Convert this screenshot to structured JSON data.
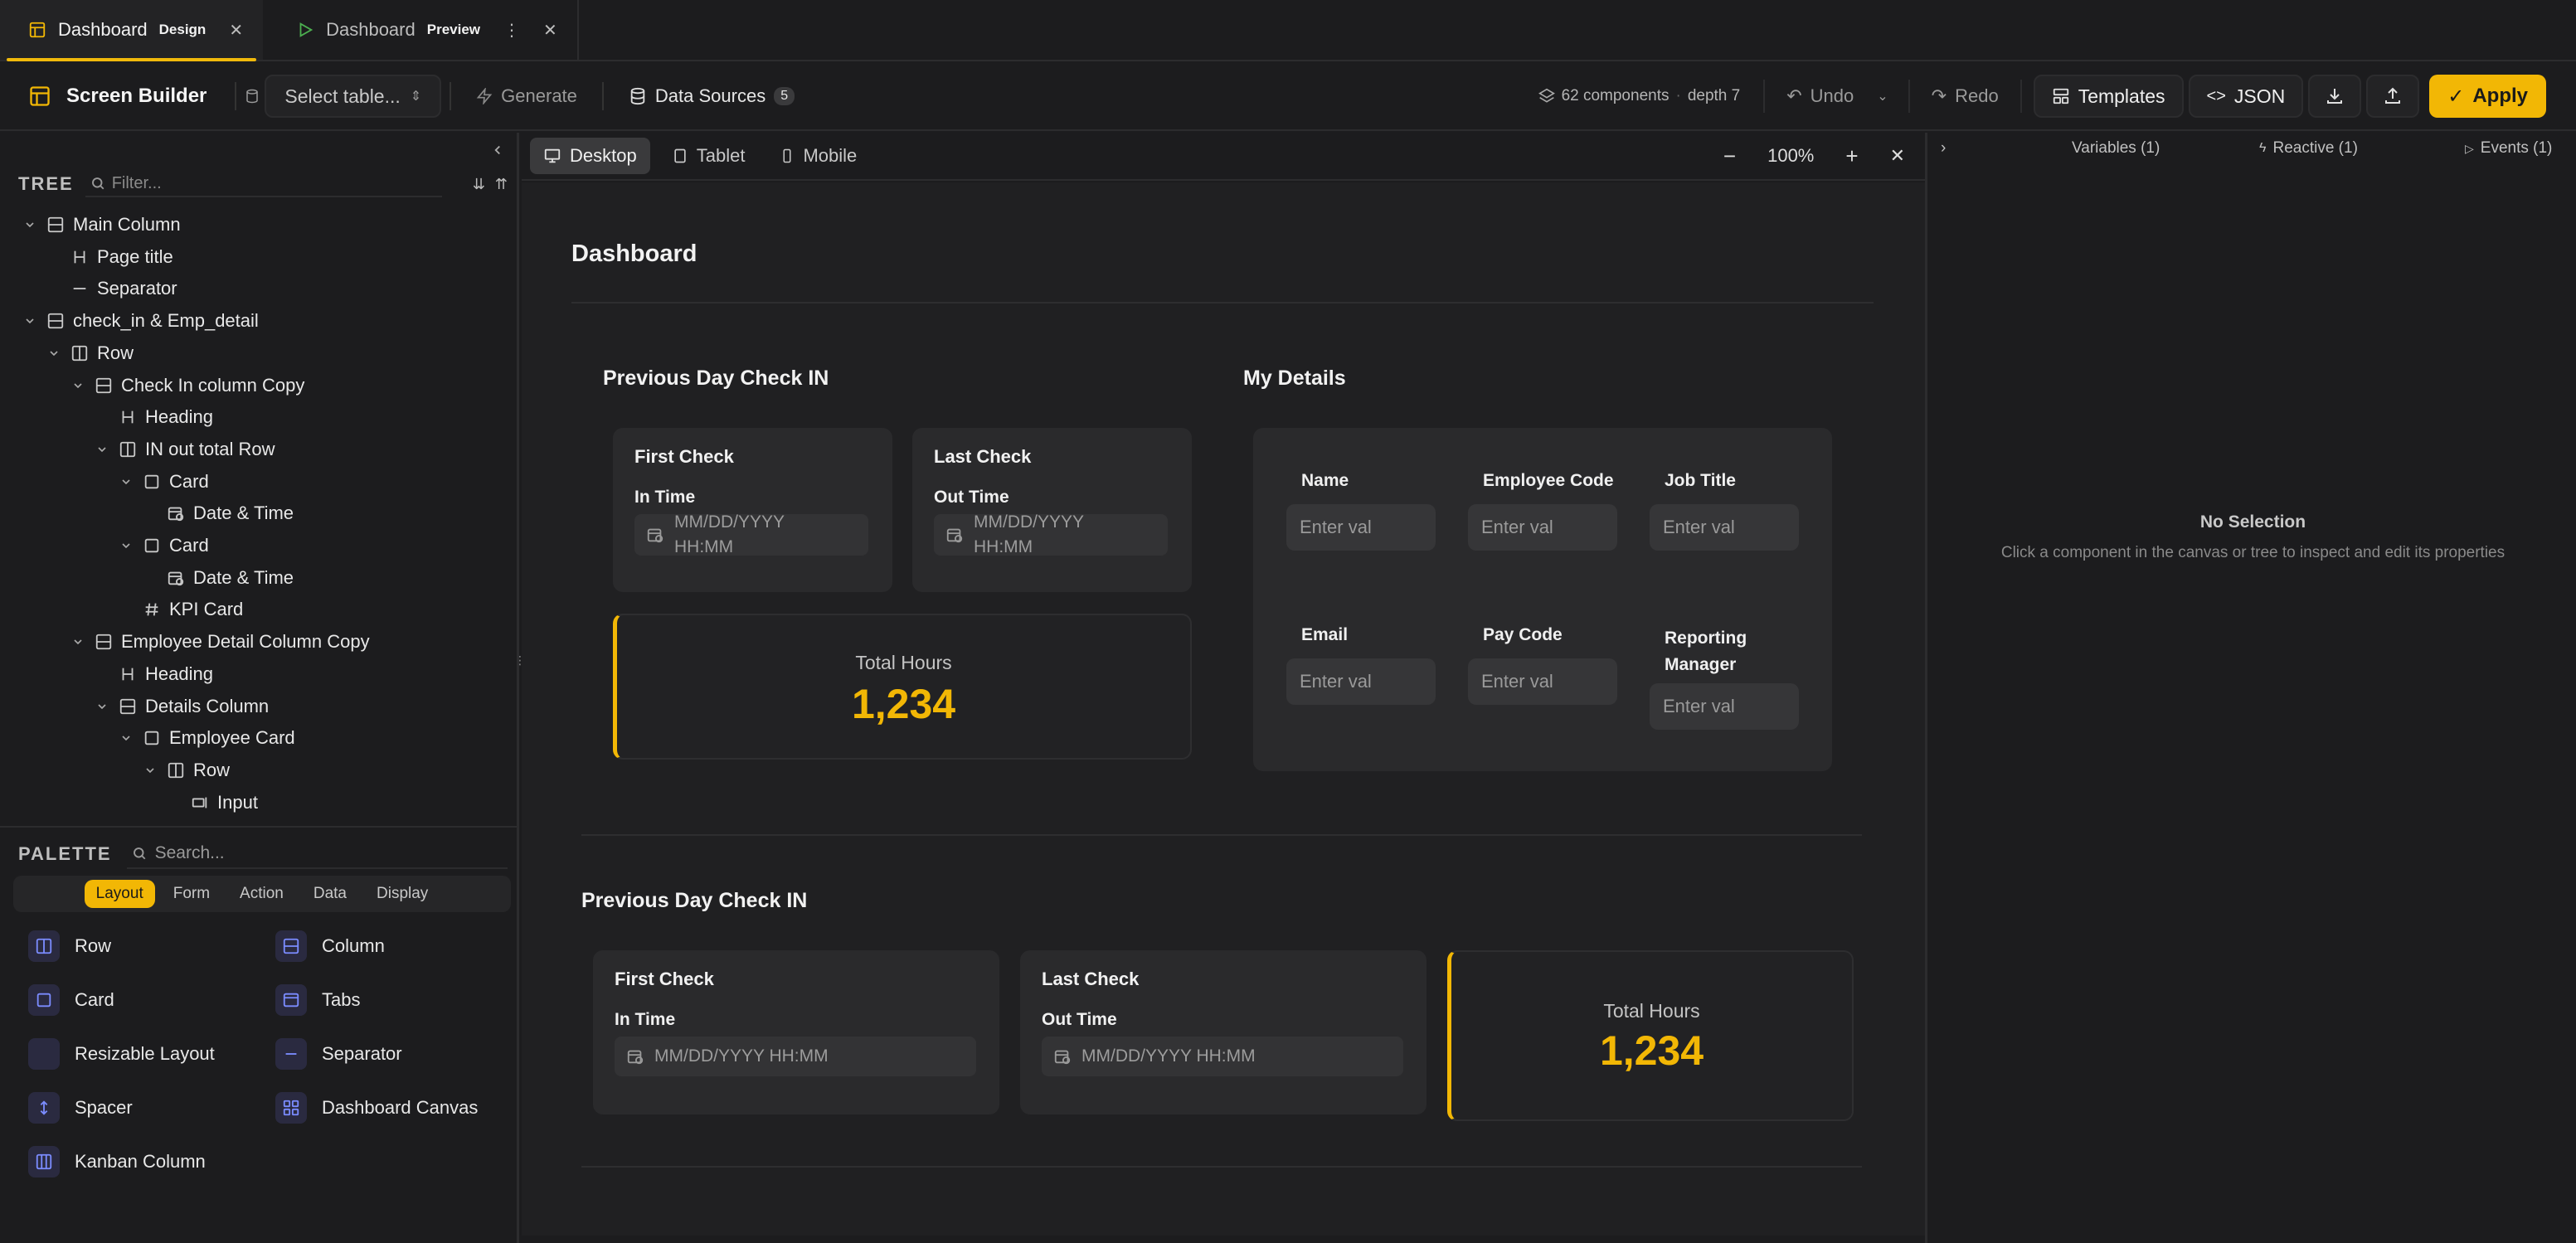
{
  "tabs": [
    {
      "label": "Dashboard",
      "badge": "Design"
    },
    {
      "label": "Dashboard",
      "badge": "Preview"
    }
  ],
  "toolbar": {
    "title": "Screen Builder",
    "select_table": "Select table...",
    "generate": "Generate",
    "data_sources": "Data Sources",
    "data_sources_count": "5",
    "components": "62 components",
    "depth": "depth 7",
    "undo": "Undo",
    "redo": "Redo",
    "templates": "Templates",
    "json": "JSON",
    "apply": "Apply"
  },
  "tree": {
    "label": "TREE",
    "filter_placeholder": "Filter...",
    "nodes": [
      {
        "label": "Main Column",
        "icon": "column-icon"
      },
      {
        "label": "Page title",
        "icon": "heading-icon"
      },
      {
        "label": "Separator",
        "icon": "separator-icon"
      },
      {
        "label": "check_in & Emp_detail",
        "icon": "column-icon"
      },
      {
        "label": "Row",
        "icon": "row-icon"
      },
      {
        "label": "Check In column Copy",
        "icon": "column-icon"
      },
      {
        "label": "Heading",
        "icon": "heading-icon"
      },
      {
        "label": "IN out total Row",
        "icon": "row-icon"
      },
      {
        "label": "Card",
        "icon": "card-icon"
      },
      {
        "label": "Date & Time",
        "icon": "calendar-clock-icon"
      },
      {
        "label": "Card",
        "icon": "card-icon"
      },
      {
        "label": "Date & Time",
        "icon": "calendar-clock-icon"
      },
      {
        "label": "KPI Card",
        "icon": "hash-icon"
      },
      {
        "label": "Employee Detail Column Copy",
        "icon": "column-icon"
      },
      {
        "label": "Heading",
        "icon": "heading-icon"
      },
      {
        "label": "Details Column",
        "icon": "column-icon"
      },
      {
        "label": "Employee Card",
        "icon": "card-icon"
      },
      {
        "label": "Row",
        "icon": "row-icon"
      },
      {
        "label": "Input",
        "icon": "input-icon"
      }
    ]
  },
  "palette": {
    "label": "PALETTE",
    "search_placeholder": "Search...",
    "categories": [
      "Layout",
      "Form",
      "Action",
      "Data",
      "Display"
    ],
    "active_category": "Layout",
    "items": [
      {
        "label": "Row",
        "icon": "row-icon"
      },
      {
        "label": "Column",
        "icon": "column-icon"
      },
      {
        "label": "Card",
        "icon": "card-icon"
      },
      {
        "label": "Tabs",
        "icon": "tabs-icon"
      },
      {
        "label": "Resizable Layout",
        "icon": "resizable-icon"
      },
      {
        "label": "Separator",
        "icon": "separator-icon"
      },
      {
        "label": "Spacer",
        "icon": "spacer-icon"
      },
      {
        "label": "Dashboard Canvas",
        "icon": "dashboard-canvas-icon"
      },
      {
        "label": "Kanban Column",
        "icon": "kanban-icon"
      }
    ]
  },
  "canvas": {
    "viewports": [
      "Desktop",
      "Tablet",
      "Mobile"
    ],
    "active_viewport": "Desktop",
    "zoom": "100%",
    "page_title": "Dashboard",
    "checkin": {
      "heading": "Previous Day Check IN",
      "first_card_title": "First Check",
      "first_label": "In Time",
      "first_placeholder": "MM/DD/YYYY HH:MM",
      "last_card_title": "Last Check",
      "last_label": "Out Time",
      "last_placeholder": "MM/DD/YYYY HH:MM",
      "kpi_label": "Total Hours",
      "kpi_value": "1,234"
    },
    "details": {
      "heading": "My Details",
      "fields": [
        {
          "label": "Name",
          "placeholder": "Enter val"
        },
        {
          "label": "Employee Code",
          "placeholder": "Enter val"
        },
        {
          "label": "Job Title",
          "placeholder": "Enter val"
        },
        {
          "label": "Email",
          "placeholder": "Enter val"
        },
        {
          "label": "Pay Code",
          "placeholder": "Enter val"
        },
        {
          "label": "Reporting Manager",
          "placeholder": "Enter val"
        }
      ]
    },
    "checkin2": {
      "heading": "Previous Day Check IN",
      "first_card_title": "First Check",
      "first_label": "In Time",
      "first_placeholder": "MM/DD/YYYY HH:MM",
      "last_card_title": "Last Check",
      "last_label": "Out Time",
      "last_placeholder": "MM/DD/YYYY HH:MM",
      "kpi_label": "Total Hours",
      "kpi_value": "1,234"
    }
  },
  "inspector": {
    "variables": "Variables (1)",
    "reactive": "Reactive (1)",
    "events": "Events (1)",
    "no_selection_title": "No Selection",
    "no_selection_subtitle": "Click a component in the canvas or tree to inspect and edit its properties"
  },
  "colors": {
    "accent": "#f2b705",
    "background": "#1c1c1e",
    "canvas": "#202022",
    "card": "#2a2a2c"
  }
}
